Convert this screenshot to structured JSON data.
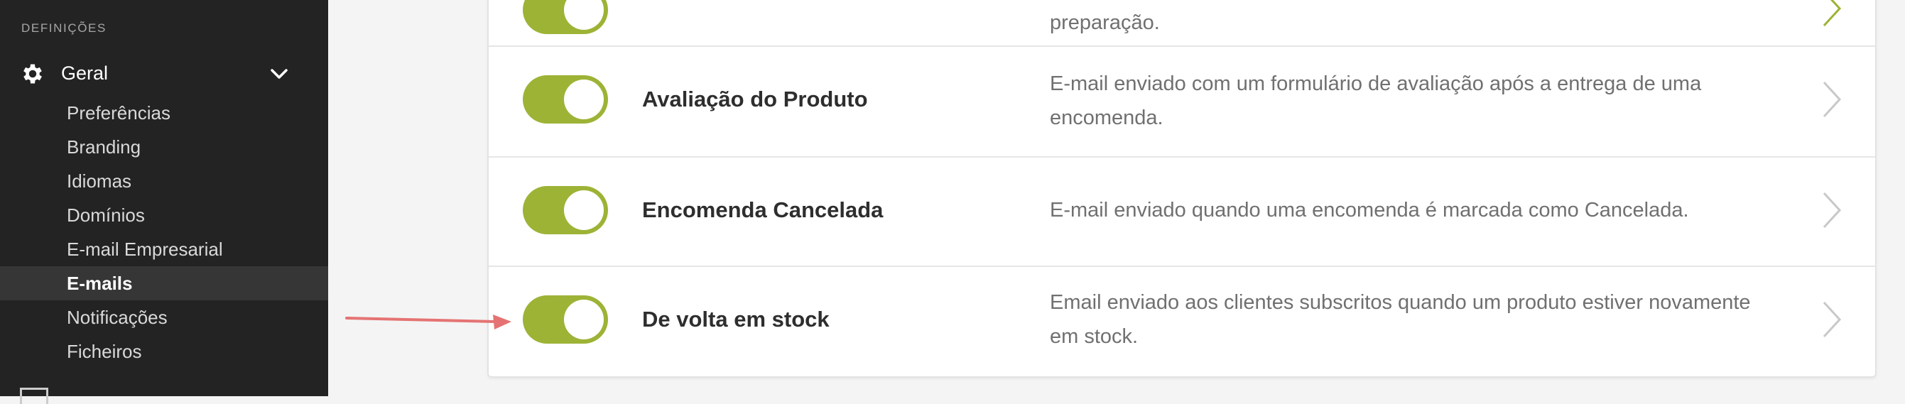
{
  "sidebar": {
    "section_header": "DEFINIÇÕES",
    "group": {
      "label": "Geral",
      "icon": "gear-icon",
      "expanded": true
    },
    "items": [
      {
        "label": "Preferências",
        "active": false
      },
      {
        "label": "Branding",
        "active": false
      },
      {
        "label": "Idiomas",
        "active": false
      },
      {
        "label": "Domínios",
        "active": false
      },
      {
        "label": "E-mail Empresarial",
        "active": false
      },
      {
        "label": "E-mails",
        "active": true
      },
      {
        "label": "Notificações",
        "active": false
      },
      {
        "label": "Ficheiros",
        "active": false
      }
    ]
  },
  "emails": {
    "rows": [
      {
        "title": "",
        "description": "preparação.",
        "enabled": true
      },
      {
        "title": "Avaliação do Produto",
        "description": "E-mail enviado com um formulário de avaliação após a entrega de uma encomenda.",
        "enabled": true
      },
      {
        "title": "Encomenda Cancelada",
        "description": "E-mail enviado quando uma encomenda é marcada como Cancelada.",
        "enabled": true
      },
      {
        "title": "De volta em stock",
        "description": "Email enviado aos clientes subscritos quando um produto estiver novamente em stock.",
        "enabled": true
      }
    ]
  },
  "colors": {
    "toggle_on": "#9cb336",
    "sidebar_bg": "#232323",
    "annotation_arrow": "#e57373"
  }
}
